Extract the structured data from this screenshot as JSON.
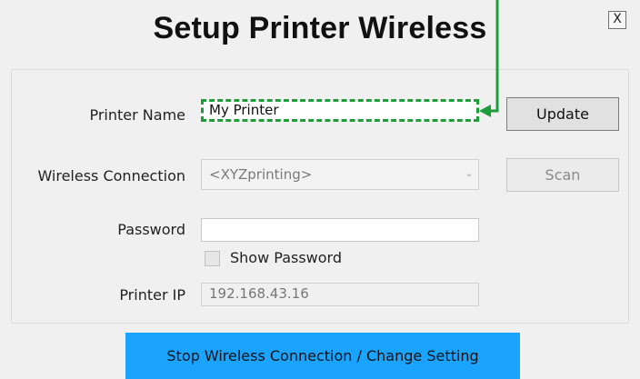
{
  "window": {
    "title": "Setup Printer Wireless",
    "close_label": "X"
  },
  "form": {
    "printer_name": {
      "label": "Printer Name",
      "value": "My Printer"
    },
    "wireless_connection": {
      "label": "Wireless Connection",
      "selected": "<XYZprinting>"
    },
    "password": {
      "label": "Password",
      "value": ""
    },
    "show_password": {
      "label": "Show Password",
      "checked": false
    },
    "printer_ip": {
      "label": "Printer IP",
      "value": "192.168.43.16"
    }
  },
  "buttons": {
    "update": "Update",
    "scan": "Scan",
    "stop": "Stop Wireless Connection / Change Setting"
  },
  "colors": {
    "highlight": "#1e9e3a",
    "primary_action": "#1aa3ff"
  },
  "icons": {
    "dropdown": "chevron-down-icon",
    "annotation": "arrow-left-icon"
  }
}
